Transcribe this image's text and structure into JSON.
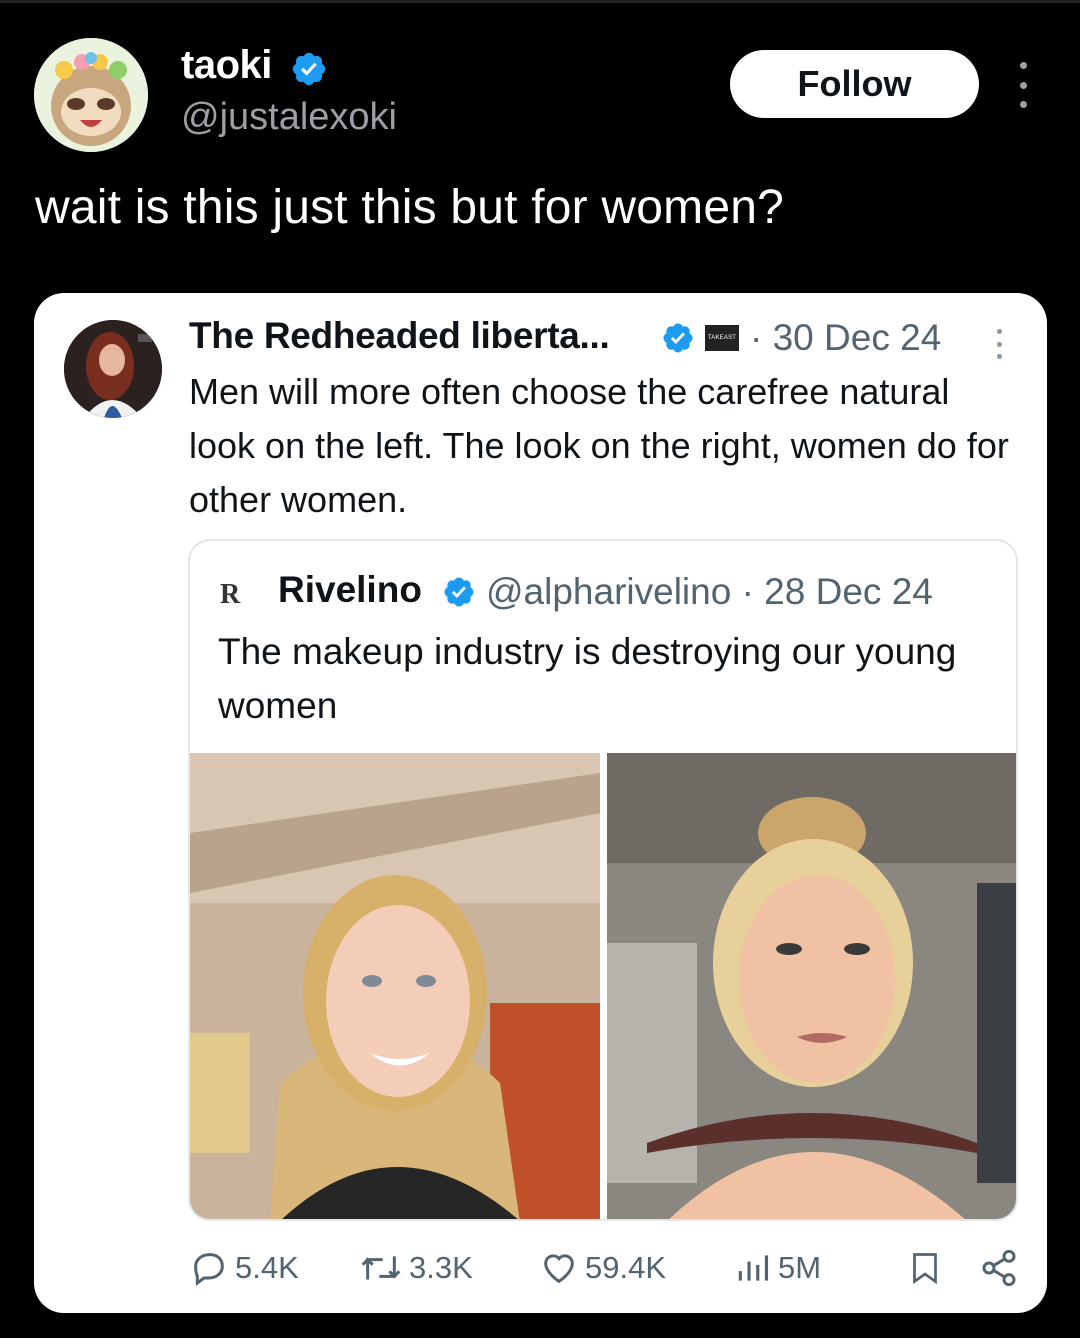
{
  "post": {
    "author_name": "taoki",
    "author_handle": "@justalexoki",
    "follow_label": "Follow",
    "text": "wait is this just this but for women?"
  },
  "quoted": {
    "author_name": "The Redheaded liberta...",
    "badge_text": "TAKEAST",
    "date": "· 30 Dec 24",
    "text": "Men will more often choose the carefree natural look on the left. The look on the right, women do for other women."
  },
  "inner_quote": {
    "logo": "R",
    "author_name": "Rivelino",
    "author_handle": "@alpharivelino · 28 Dec 24",
    "text": "The makeup industry is destroying our young women"
  },
  "actions": {
    "replies": "5.4K",
    "reposts": "3.3K",
    "likes": "59.4K",
    "views": "5M"
  },
  "colors": {
    "verified_blue": "#1d9bf0",
    "follow_bg": "#ffffff",
    "page_bg": "#000000",
    "muted_text": "#536471"
  },
  "icons": [
    "verified-icon",
    "more-icon",
    "reply-icon",
    "repost-icon",
    "like-icon",
    "views-icon",
    "bookmark-icon",
    "share-icon"
  ]
}
